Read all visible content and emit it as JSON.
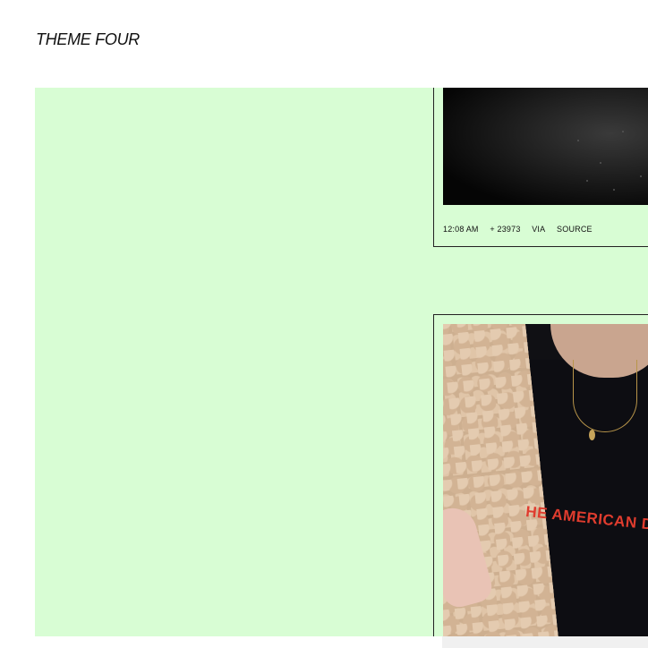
{
  "site": {
    "title": "THEME FOUR"
  },
  "posts": [
    {
      "type": "photo",
      "photo_desc_icon": "dark-photo-icon",
      "meta": {
        "time": "12:08 AM",
        "notes": "+ 23973",
        "via": "VIA",
        "source": "SOURCE"
      }
    },
    {
      "type": "photo",
      "photo_desc_icon": "portrait-photo-icon",
      "shirt_text": "HE AMERICAN DR"
    }
  ],
  "colors": {
    "content_bg": "#d8fdd4",
    "page_bg": "#ffffff",
    "border": "#222222"
  }
}
